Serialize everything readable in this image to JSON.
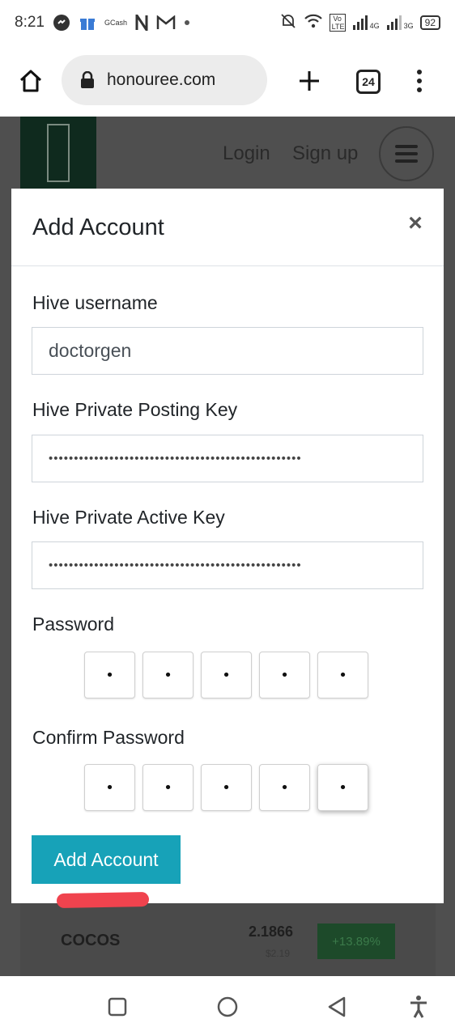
{
  "status_bar": {
    "time": "8:21",
    "icons": [
      "messenger-icon",
      "gift-icon",
      "gcash-icon",
      "n-icon",
      "gmail-icon",
      "dot-icon"
    ],
    "gcash_label": "GCash",
    "right_icons": [
      "mute-icon",
      "wifi-icon",
      "volte-icon",
      "signal-4g-icon",
      "signal-3g-icon"
    ],
    "volte_label": "Vo LTE",
    "net_4g": "4G",
    "net_3g": "3G",
    "battery": "92"
  },
  "browser": {
    "url": "honouree.com",
    "tab_count": "24"
  },
  "site": {
    "login": "Login",
    "signup": "Sign up",
    "coin_name": "COCOS",
    "coin_price": "2.1866",
    "coin_usd": "$2.19",
    "coin_change": "+13.89%"
  },
  "modal": {
    "title": "Add Account",
    "close": "×",
    "username_label": "Hive username",
    "username_value": "doctorgen",
    "posting_label": "Hive Private Posting Key",
    "posting_value": "••••••••••••••••••••••••••••••••••••••••••••••••••",
    "active_label": "Hive Private Active Key",
    "active_value": "••••••••••••••••••••••••••••••••••••••••••••••••••",
    "password_label": "Password",
    "password_digits": [
      "•",
      "•",
      "•",
      "•",
      "•"
    ],
    "confirm_label": "Confirm Password",
    "confirm_digits": [
      "•",
      "•",
      "•",
      "•",
      "•"
    ],
    "submit": "Add Account"
  },
  "colors": {
    "primary_button": "#17a2b8",
    "annotation_mark": "#f0434e",
    "overlay": "#4f4f4f"
  }
}
